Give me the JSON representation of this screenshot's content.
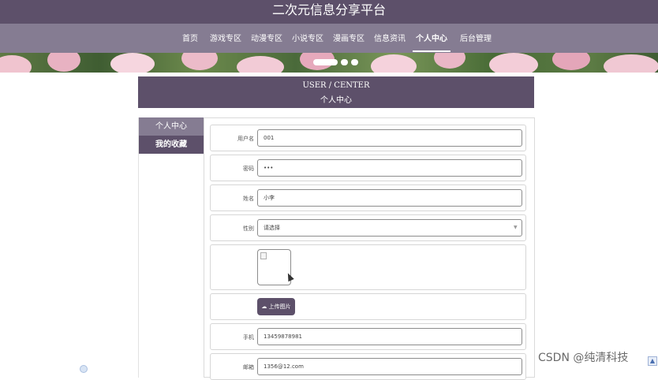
{
  "app": {
    "title": "二次元信息分享平台"
  },
  "nav": {
    "items": [
      {
        "label": "首页"
      },
      {
        "label": "游戏专区"
      },
      {
        "label": "动漫专区"
      },
      {
        "label": "小说专区"
      },
      {
        "label": "漫画专区"
      },
      {
        "label": "信息资讯"
      },
      {
        "label": "个人中心",
        "active": true
      },
      {
        "label": "后台管理"
      }
    ]
  },
  "banner": {
    "slides": 3,
    "current": 1
  },
  "center": {
    "title_en": "USER / CENTER",
    "title_cn": "个人中心"
  },
  "sidebar": {
    "items": [
      {
        "label": "个人中心"
      },
      {
        "label": "我的收藏"
      }
    ]
  },
  "form": {
    "username": {
      "label": "用户名",
      "value": "001"
    },
    "password": {
      "label": "密码",
      "value": "•••"
    },
    "name": {
      "label": "姓名",
      "value": "小李"
    },
    "gender": {
      "label": "性别",
      "value": "请选择"
    },
    "upload": {
      "label": "上传图片"
    },
    "phone": {
      "label": "手机",
      "value": "13459878981"
    },
    "email": {
      "label": "邮箱",
      "value": "1356@12.com"
    }
  },
  "watermark": {
    "text": "CSDN @纯清科技"
  },
  "colors": {
    "primary": "#5d506a",
    "nav": "#857c92",
    "accent_active": "#ffffff"
  },
  "icons": {
    "upload": "cloud-upload-icon",
    "select": "chevron-down-icon"
  }
}
